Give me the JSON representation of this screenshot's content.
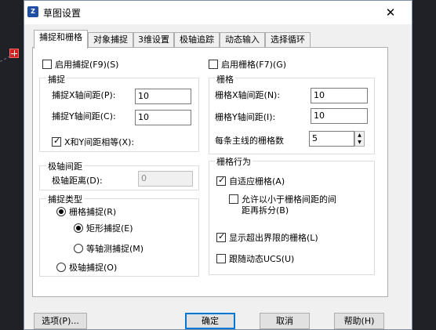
{
  "window": {
    "title": "草图设置",
    "close_icon": "close-icon"
  },
  "tabs": [
    "捕捉和栅格",
    "对象捕捉",
    "3维设置",
    "极轴追踪",
    "动态输入",
    "选择循环"
  ],
  "snap": {
    "enable_label": "启用捕捉(F9)(S)",
    "group_title": "捕捉",
    "x_label": "捕捉X轴间距(P):",
    "x_value": "10",
    "y_label": "捕捉Y轴间距(C):",
    "y_value": "10",
    "equal_label": "X和Y间距相等(X):"
  },
  "polar": {
    "group_title": "极轴间距",
    "distance_label": "极轴距离(D):",
    "distance_value": "0"
  },
  "snap_type": {
    "group_title": "捕捉类型",
    "grid_snap": "栅格捕捉(R)",
    "rect_snap": "矩形捕捉(E)",
    "iso_snap": "等轴测捕捉(M)",
    "polar_snap": "极轴捕捉(O)"
  },
  "grid": {
    "enable_label": "启用栅格(F7)(G)",
    "group_title": "栅格",
    "x_label": "栅格X轴间距(N):",
    "x_value": "10",
    "y_label": "栅格Y轴间距(I):",
    "y_value": "10",
    "major_label": "每条主线的栅格数",
    "major_value": "5"
  },
  "grid_behavior": {
    "group_title": "栅格行为",
    "adaptive": "自适应栅格(A)",
    "subdivide_line1": "允许以小于栅格间距的间",
    "subdivide_line2": "距再拆分(B)",
    "beyond_limits": "显示超出界限的栅格(L)",
    "follow_ucs": "跟随动态UCS(U)"
  },
  "buttons": {
    "options": "选项(P)...",
    "ok": "确定",
    "cancel": "取消",
    "help": "帮助(H)"
  }
}
